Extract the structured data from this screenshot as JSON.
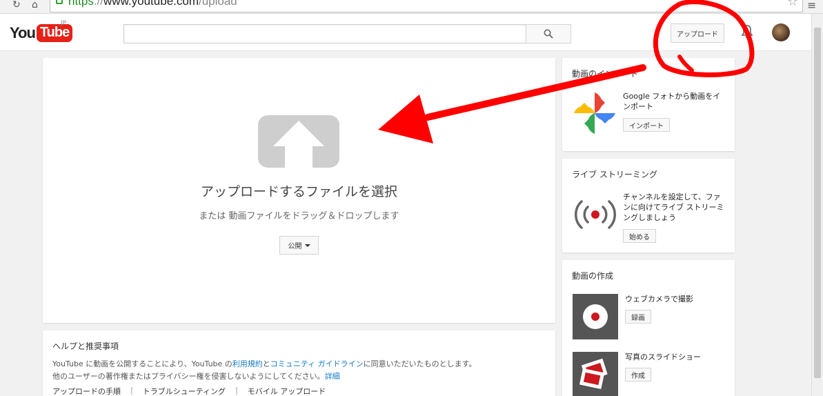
{
  "browser": {
    "url_scheme": "https",
    "url_separator": "://",
    "url_host": "www.youtube.com",
    "url_path": "/upload"
  },
  "header": {
    "logo_you": "You",
    "logo_tube": "Tube",
    "logo_region": "JP",
    "search_value": "",
    "upload_label": "アップロード"
  },
  "upload": {
    "title": "アップロードするファイルを選択",
    "subtitle": "または 動画ファイルをドラッグ＆ドロップします",
    "privacy_label": "公開"
  },
  "help": {
    "title": "ヘルプと推奨事項",
    "line1_a": "YouTube に動画を公開することにより、YouTube の",
    "line1_link1": "利用規約",
    "line1_b": "と",
    "line1_link2": "コミュニティ ガイドライン",
    "line1_c": "に同意いただいたものとします。",
    "line2_a": "他のユーザーの著作権またはプライバシー権を侵害しないようにしてください。",
    "line2_link": "詳細",
    "links": [
      "アップロードの手順",
      "トラブルシューティング",
      "モバイル アップロード"
    ]
  },
  "sidebar": {
    "import": {
      "title": "動画のインポート",
      "description": "Google フォトから動画をインポート",
      "button": "インポート"
    },
    "live": {
      "title": "ライブ ストリーミング",
      "description": "チャンネルを設定して、ファンに向けてライブ ストリーミングしましょう",
      "button": "始める"
    },
    "create": {
      "title": "動画の作成",
      "webcam_label": "ウェブカメラで撮影",
      "webcam_button": "録画",
      "slideshow_label": "写真のスライドショー",
      "slideshow_button": "作成"
    }
  },
  "colors": {
    "youtube_red": "#e62117",
    "link_blue": "#167ac6",
    "annotation_red": "#ff0000"
  }
}
